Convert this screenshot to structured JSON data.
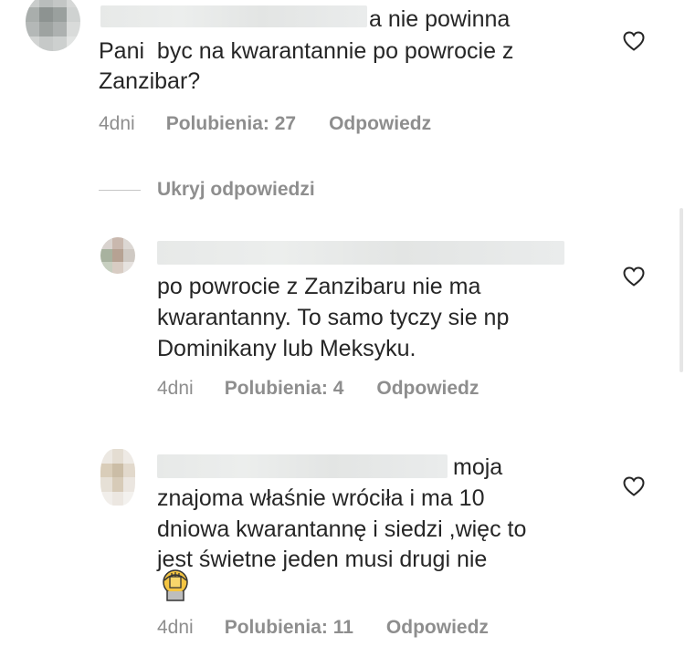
{
  "comments": [
    {
      "line_1": "a nie powinna",
      "line_2": "Pani  byc na kwarantannie po powrocie z",
      "line_3": "Zanzibar?",
      "time": "4dni",
      "likes": "Polubienia: 27",
      "reply": "Odpowiedz"
    }
  ],
  "hide_replies_label": "Ukryj odpowiedzi",
  "replies": [
    {
      "line_1": "po powrocie z Zanzibaru nie ma",
      "line_2": "kwarantanny. To samo tyczy sie np",
      "line_3": "Dominikany lub Meksyku.",
      "time": "4dni",
      "likes": "Polubienia: 4",
      "reply": "Odpowiedz"
    },
    {
      "line_1": "moja",
      "line_2": "znajoma właśnie wróciła i ma 10",
      "line_3": "dniowa kwarantannę i siedzi ,więc to",
      "line_4": "jest świetne jeden musi drugi nie",
      "emoji": "face-palm-emoji",
      "time": "4dni",
      "likes": "Polubienia: 11",
      "reply": "Odpowiedz"
    }
  ],
  "colors": {
    "text": "#262626",
    "meta": "#8e8e8e",
    "divider": "#c7c7c7",
    "blur": "#e7e9e8"
  },
  "icons": {
    "like": "heart-outline-icon"
  }
}
